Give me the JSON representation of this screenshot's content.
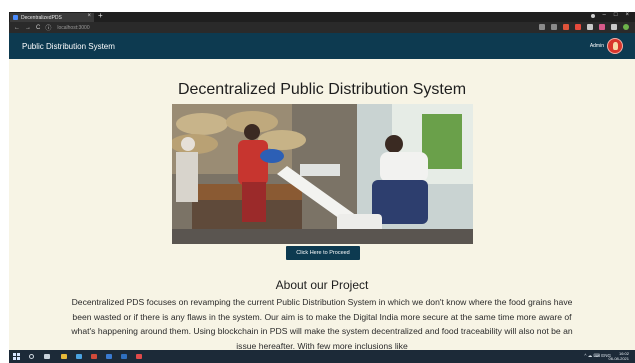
{
  "browser": {
    "tab_title": "DecentralizedPDS",
    "tab_close": "×",
    "new_tab": "+",
    "address": "localhost:3000",
    "back": "←",
    "forward": "→",
    "reload": "C",
    "info": "ⓘ",
    "window_minimize": "–",
    "window_maximize": "□",
    "window_close": "×"
  },
  "navbar": {
    "brand": "Public Distribution System",
    "user_label": "Admin",
    "bg_color": "#0d3a50"
  },
  "hero": {
    "title": "Decentralized Public Distribution System",
    "proceed_button": "Click Here to Proceed"
  },
  "about": {
    "title": "About our Project",
    "body": "Decentralized PDS focuses on revamping the current Public Distribution System in which we don't know where the food grains have been wasted or if there is any flaws in the system. Our aim is to make the Digital India more secure at the same time more aware of what's happening around them. Using blockchain in PDS will make the system decentralized and food traceability will also not be an issue hereafter. With few more inclusions like"
  },
  "taskbar": {
    "tray_text": "^ ☁ ⌨ ENG",
    "time": "16:02",
    "date": "06-08-2021"
  },
  "colors": {
    "page_bg": "#f7f4e5",
    "navbar": "#0d3a50",
    "button": "#0d3a50",
    "taskbar": "#1c2a38"
  }
}
